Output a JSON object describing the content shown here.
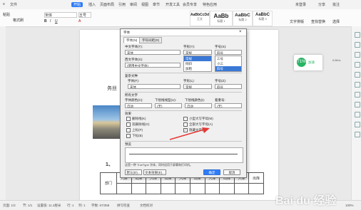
{
  "titlebar": {
    "tabs": [
      "文件",
      "开始",
      "插入",
      "页面布局",
      "引用",
      "审阅",
      "视图",
      "章节",
      "开发工具",
      "会员专享",
      "特色应用"
    ],
    "active_tab": "开始",
    "right_items": [
      "未登录",
      "分享",
      "批注"
    ]
  },
  "ribbon": {
    "left_labels": [
      "粘贴",
      "格式刷"
    ],
    "font_name": "宋体",
    "font_size": "五号",
    "styles": [
      {
        "sample": "AaBbCcDd",
        "caption": "正文"
      },
      {
        "sample": "AaBb",
        "caption": "标题 1"
      },
      {
        "sample": "AaBbC",
        "caption": "标题 2"
      },
      {
        "sample": "AaBbC",
        "caption": "标题 3"
      }
    ],
    "right_labels": [
      "文字排版",
      "查找替换",
      "选择"
    ]
  },
  "dialog": {
    "title": "字体",
    "tabs": [
      "字体(N)",
      "字符间距(R)"
    ],
    "chinese_font_label": "中文字体(T):",
    "chinese_font_value": "宋体",
    "font_style_label": "字形(Y):",
    "font_style_value": "常规",
    "size_label": "字号(S):",
    "size_value": "四号",
    "style_list": [
      "常规",
      "倾斜",
      "加粗"
    ],
    "size_list": [
      "三号",
      "小三",
      "四号"
    ],
    "western_font_label": "西文字体(X):",
    "western_font_value": "(使用中文字体)",
    "complex_section": "复杂文种",
    "complex_font_label": "字体(F):",
    "complex_font_value": "宋体",
    "complex_style_label": "字形(L):",
    "complex_style_value": "常规",
    "complex_size_label": "字号(Z):",
    "complex_size_value": "四号",
    "all_text_section": "所有文字",
    "font_color_label": "字体颜色(C):",
    "font_color_value": "自动",
    "underline_label": "下划线线型(U):",
    "underline_value": "(无)",
    "underline_color_label": "下划线颜色(I):",
    "underline_color_value": "自动",
    "emphasis_label": "着重号:",
    "emphasis_value": "(无)",
    "effects_section": "效果",
    "effects_left": [
      "删除线(K)",
      "双删除线(G)",
      "上标(P)",
      "下标(B)"
    ],
    "effects_right": [
      "小型大写字母(M)",
      "全部大写字母(A)",
      "隐藏文字(H)"
    ],
    "effects_right_checked": [
      false,
      false,
      true
    ],
    "preview_section": "预览",
    "note": "这是一种 TrueType 字体，同时适用于屏幕和打印机。",
    "buttons": {
      "default": "默认(D)...",
      "text_effects": "文本效果(E)...",
      "ok": "确定",
      "cancel": "取消"
    }
  },
  "document": {
    "side_text": "务丝",
    "heading_fragment": "1、",
    "table_row_header": "部门",
    "table_cells": [
      "入库",
      "出库",
      "入库",
      "出库",
      "入库",
      "出库",
      "入库",
      "出库",
      "入库",
      "出库"
    ]
  },
  "network_popup": {
    "label": "加速",
    "percent": "71%",
    "speed": "0.6K/s"
  },
  "statusbar": {
    "items": [
      "页面: 1/2",
      "节: 1/1",
      "设置值: 11.3厘米",
      "行: 1",
      "列: 1",
      "字数: 67/358",
      "拼写检查",
      "文档校对"
    ],
    "zoom": "100%"
  },
  "watermark": "Bai du 经验",
  "colors": {
    "accent": "#2f7cf6",
    "dialog_bg": "#f0f0f0",
    "selection": "#3a78d6",
    "arrow": "#e53935",
    "network": "#28b463"
  }
}
